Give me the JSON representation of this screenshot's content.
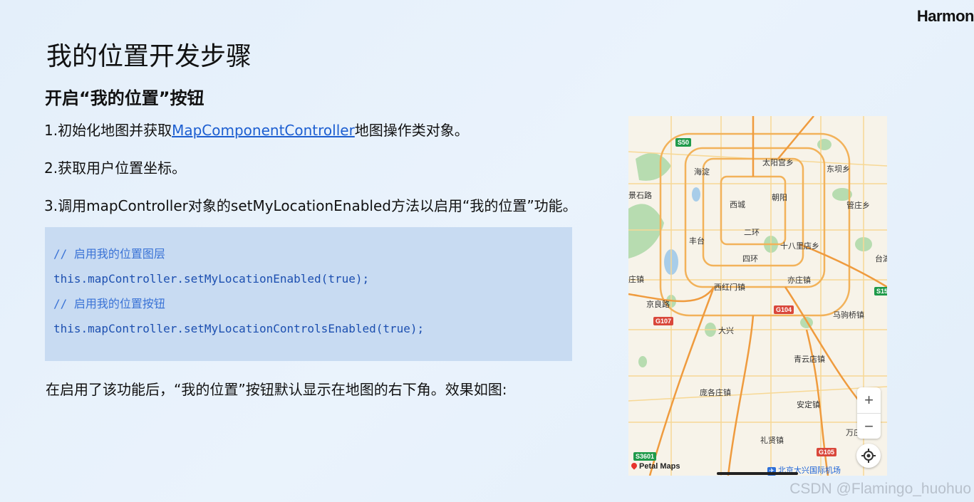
{
  "brand": "Harmon",
  "title": "我的位置开发步骤",
  "subtitle": "开启“我的位置”按钮",
  "steps": {
    "s1_prefix": "1.初始化地图并获取",
    "s1_link": "MapComponentController",
    "s1_suffix": "地图操作类对象。",
    "s2": "2.获取用户位置坐标。",
    "s3": "3.调用mapController对象的setMyLocationEnabled方法以启用“我的位置”功能。"
  },
  "code": {
    "line1": "// 启用我的位置图层",
    "line2": "this.mapController.setMyLocationEnabled(true);",
    "line3": "// 启用我的位置按钮",
    "line4": "this.mapController.setMyLocationControlsEnabled(true);"
  },
  "note": "在启用了该功能后，“我的位置”按钮默认显示在地图的右下角。效果如图:",
  "map": {
    "labels": {
      "haidian": "海淀",
      "taiyanggong": "太阳宫乡",
      "dongba": "东坝乡",
      "shijingshan": "景石路",
      "xicheng": "西城",
      "chaoyang": "朝阳",
      "guanzhuang": "管庄乡",
      "erhuan": "二环",
      "fengtai": "丰台",
      "shibalidian": "十八里店乡",
      "sihuan": "四环",
      "tai": "台湖",
      "zhuang": "庄镇",
      "yizhuang": "亦庄镇",
      "xihongmen": "西红门镇",
      "jingliang": "京良路",
      "majuqiao": "马驹桥镇",
      "daxing": "大兴",
      "qingyundian": "青云店镇",
      "pangezhuang": "庞各庄镇",
      "anding": "安定镇",
      "fangezhuang": "万庄",
      "lixian": "礼贤镇"
    },
    "shields": {
      "s50": "S50",
      "g107": "G107",
      "g104": "G104",
      "s15": "S15",
      "s3601": "S3601",
      "g105": "G105"
    },
    "zoom_in": "+",
    "zoom_out": "−",
    "attribution": "Petal Maps",
    "airport": "北京大兴国际机场",
    "colors": {
      "highway": "#f3a24a",
      "arterial": "#f7cd7a",
      "green": "#a9d7a6",
      "water": "#9fc9ea"
    }
  },
  "watermark": "CSDN @Flamingo_huohuo"
}
